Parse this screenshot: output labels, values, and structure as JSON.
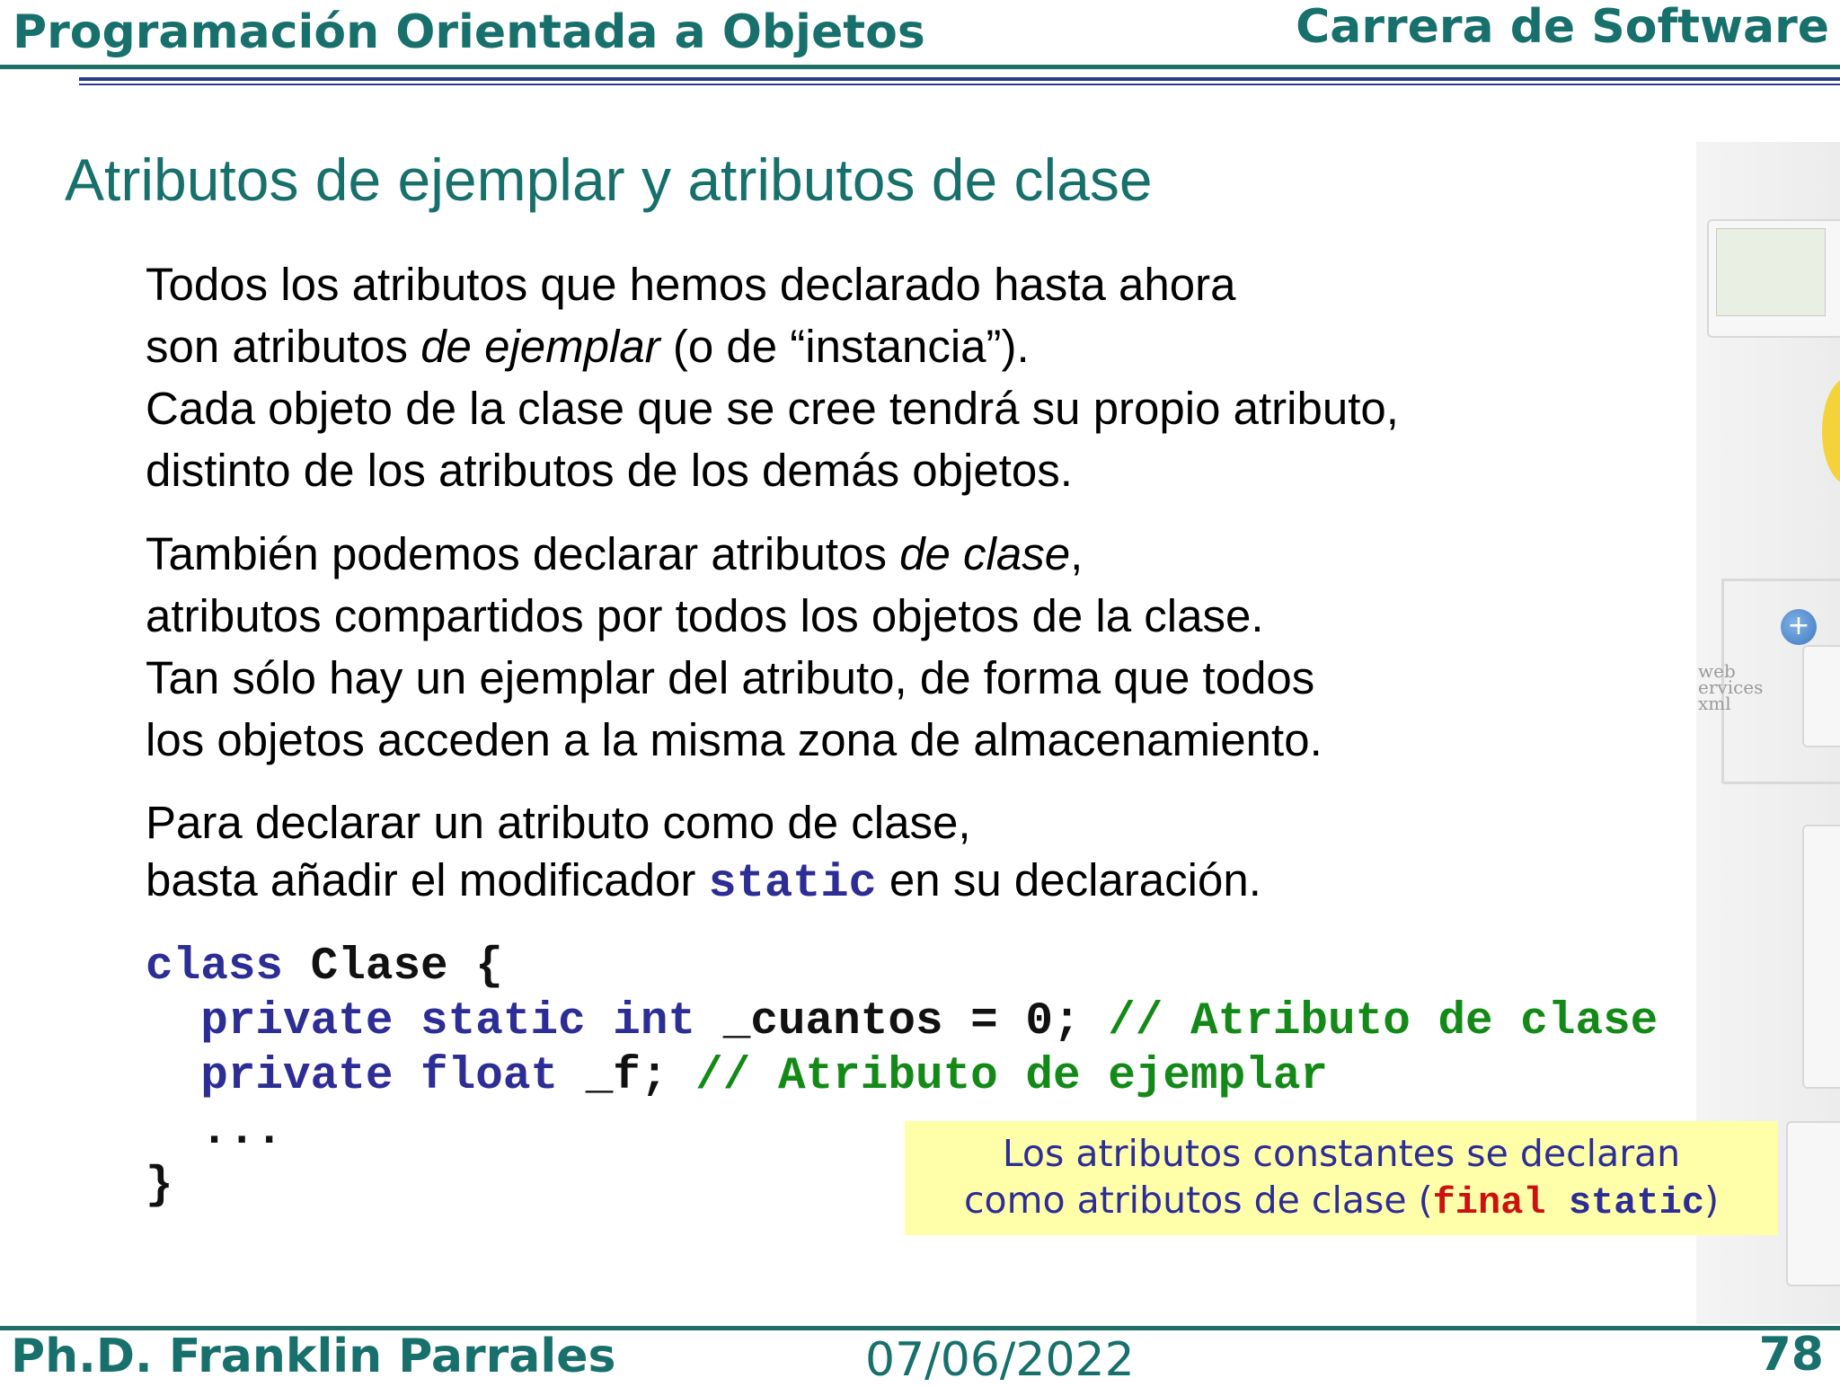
{
  "header": {
    "course": "Programación Orientada a Objetos",
    "program": "Carrera de Software"
  },
  "slide": {
    "title": "Atributos de ejemplar y atributos de clase",
    "para1": {
      "line1": "Todos los atributos que hemos declarado hasta ahora",
      "line2_a": "son atributos ",
      "line2_em": "de ejemplar",
      "line2_b": " (o de “instancia”).",
      "line3": "Cada objeto de la clase que se cree tendrá su propio atributo,",
      "line4": "distinto de los atributos de los demás objetos."
    },
    "para2": {
      "line1_a": "También podemos declarar atributos ",
      "line1_em": "de clase",
      "line1_b": ",",
      "line2": "atributos compartidos por todos los objetos de la clase.",
      "line3": "Tan sólo hay un ejemplar del atributo, de forma que todos",
      "line4": "los objetos acceden a la misma zona de almacenamiento."
    },
    "para3": {
      "line1": "Para declarar un atributo como de clase,",
      "line2_a": "basta añadir el modificador ",
      "line2_kw": "static",
      "line2_b": " en su declaración."
    },
    "code": {
      "l1_kw": "class",
      "l1_rest": " Clase {",
      "l2_indent": "  ",
      "l2_kw": "private static int",
      "l2_rest": " _cuantos = 0; ",
      "l2_comment": "// Atributo de clase",
      "l3_indent": "  ",
      "l3_kw": "private float",
      "l3_rest": " _f; ",
      "l3_comment": "// Atributo de ejemplar",
      "l4": "  ...",
      "l5": "}"
    },
    "note": {
      "line1": "Los atributos constantes se declaran",
      "line2_a": "como atributos de clase (",
      "line2_final": "final",
      "line2_static": " static",
      "line2_b": ")"
    }
  },
  "footer": {
    "author": "Ph.D. Franklin Parrales",
    "date": "07/06/2022",
    "page": "78"
  },
  "decor": {
    "ws_line1": "web",
    "ws_line2": "ervices",
    "ws_line3": "xml",
    "plus": "+"
  }
}
